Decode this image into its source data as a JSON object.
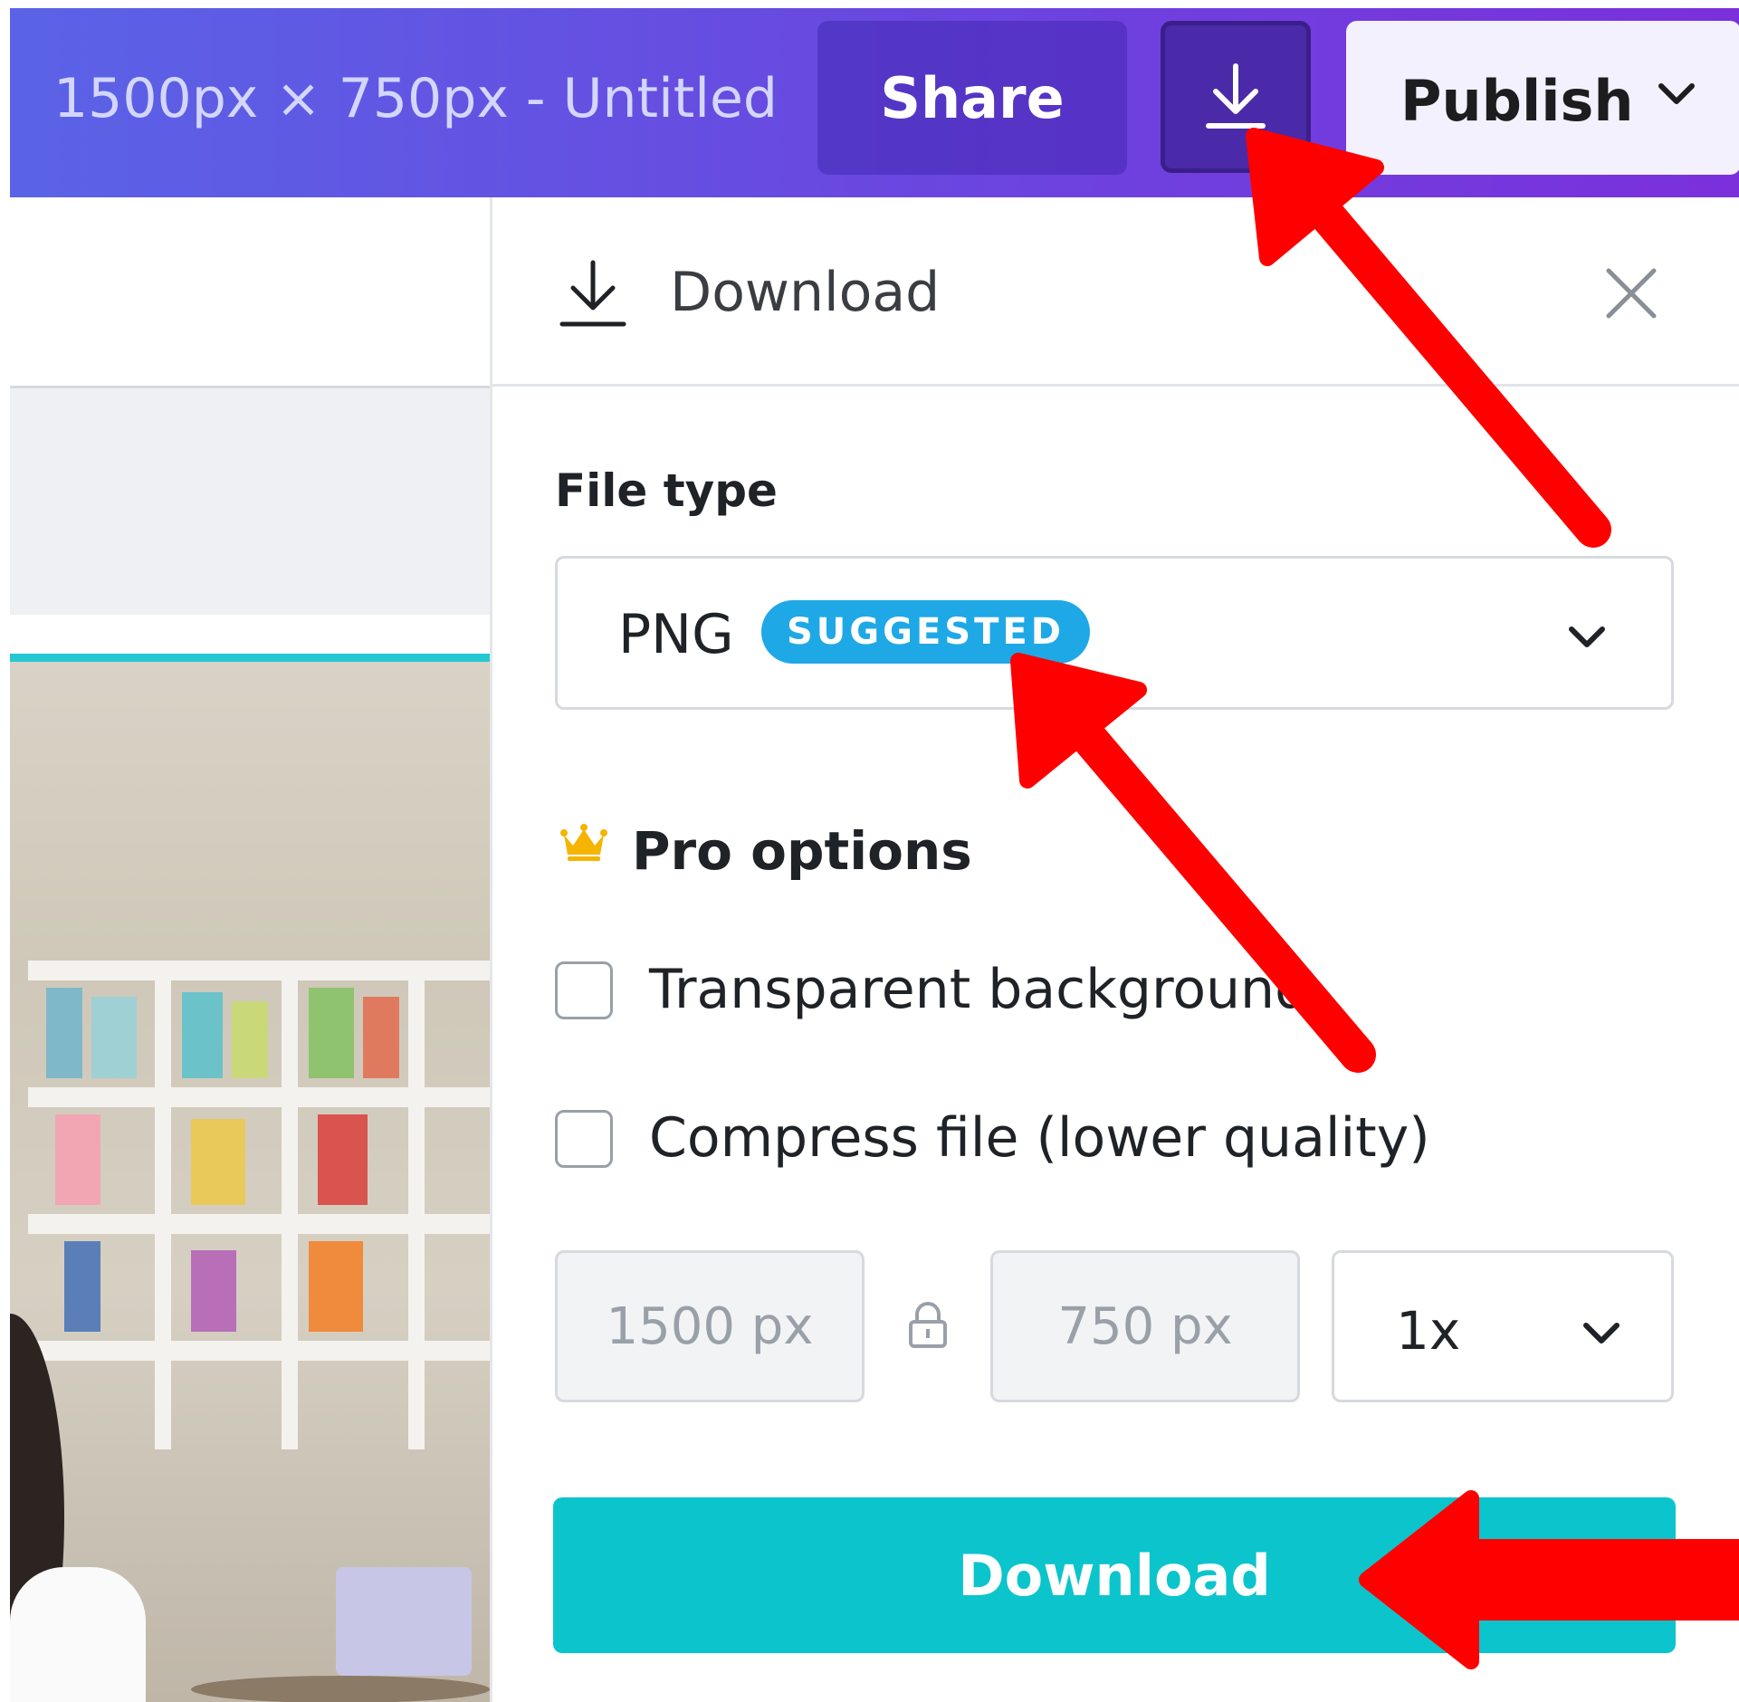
{
  "topbar": {
    "doc_title": "1500px × 750px - Untitled",
    "share_label": "Share",
    "publish_label": "Publish"
  },
  "panel": {
    "title": "Download",
    "file_type_label": "File type",
    "file_type_value": "PNG",
    "file_type_badge": "SUGGESTED",
    "pro_options_label": "Pro options",
    "option_transparent": "Transparent background",
    "option_compress": "Compress file (lower quality)",
    "width_value": "1500 px",
    "height_value": "750 px",
    "scale_value": "1x",
    "download_button_label": "Download"
  },
  "colors": {
    "topbar_gradient_start": "#5a63e6",
    "topbar_gradient_end": "#7b30dc",
    "badge": "#1fa8e6",
    "download_button": "#0cc4cc",
    "annotation_arrow": "#ff0000",
    "crown": "#f5b400"
  },
  "icons": [
    "download-icon",
    "chevron-down-icon",
    "close-icon",
    "crown-icon",
    "lock-icon"
  ]
}
